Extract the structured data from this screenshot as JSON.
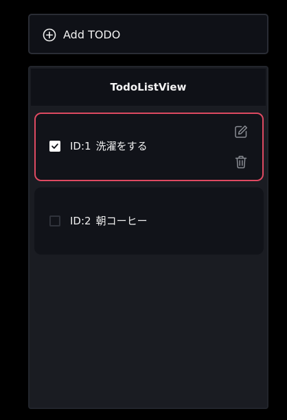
{
  "add_button": {
    "label": "Add TODO",
    "icon": "plus-circle-icon"
  },
  "todo_list": {
    "title": "TodoListView",
    "items": [
      {
        "id_label": "ID:1",
        "text": "洗濯をする",
        "checked": true,
        "selected": true,
        "actions": [
          "edit-icon",
          "delete-icon"
        ]
      },
      {
        "id_label": "ID:2",
        "text": "朝コーヒー",
        "checked": false,
        "selected": false
      }
    ]
  },
  "colors": {
    "background": "#000000",
    "panel": "#1a1c22",
    "card": "#111319",
    "selected_border": "#e04a62",
    "text": "#f1f1f1",
    "icon_muted": "#8a8d94"
  }
}
